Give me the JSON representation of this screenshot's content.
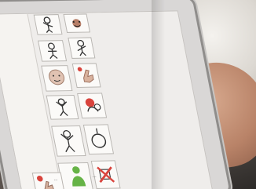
{
  "labels": {
    "small_note": "...",
    "left_card_note": "..."
  },
  "colors": {
    "screen_bg": "#efedeb",
    "card_bg": "#fbfaf8",
    "red": "#d9443d",
    "green": "#66b346",
    "skin": "#d7a98e"
  },
  "icons": [
    "waving-person-icon",
    "person-icon",
    "hand-stop-icon",
    "hand-point-icon",
    "face-icon",
    "person-arms-up-icon",
    "circle-icon",
    "cancel-icon"
  ]
}
